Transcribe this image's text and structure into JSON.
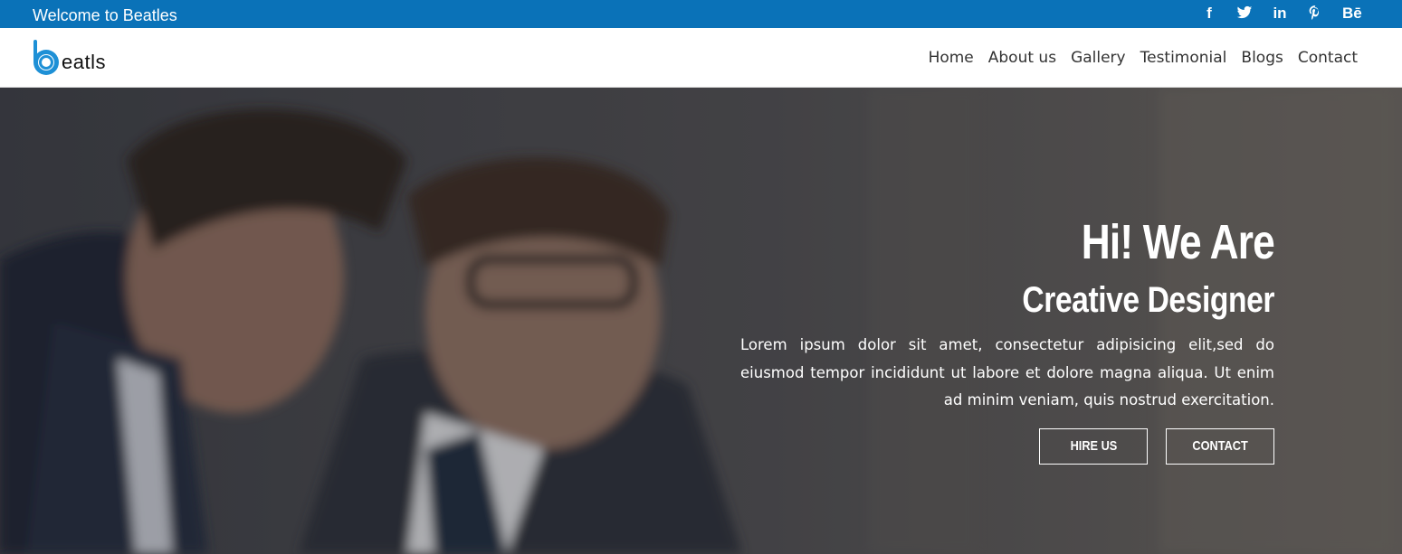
{
  "topbar": {
    "welcome": "Welcome to Beatles",
    "social": [
      {
        "icon": "facebook-icon",
        "label": "f"
      },
      {
        "icon": "twitter-icon",
        "label": ""
      },
      {
        "icon": "linkedin-icon",
        "label": "in"
      },
      {
        "icon": "pinterest-icon",
        "label": ""
      },
      {
        "icon": "behance-icon",
        "label": "Bē"
      }
    ]
  },
  "nav": {
    "logo_text": "eatls",
    "items": [
      "Home",
      "About us",
      "Gallery",
      "Testimonial",
      "Blogs",
      "Contact"
    ]
  },
  "hero": {
    "title": "Hi! We Are",
    "subtitle": "Creative Designer",
    "description": "Lorem ipsum dolor sit amet, consectetur adipisicing elit,sed do eiusmod tempor incididunt ut labore et dolore magna aliqua. Ut enim ad minim veniam, quis nostrud exercitation.",
    "buttons": {
      "hire": "HIRE US",
      "contact": "CONTACT"
    }
  },
  "colors": {
    "accent": "#0a72b8",
    "text": "#333333",
    "hero_text": "#ffffff"
  }
}
